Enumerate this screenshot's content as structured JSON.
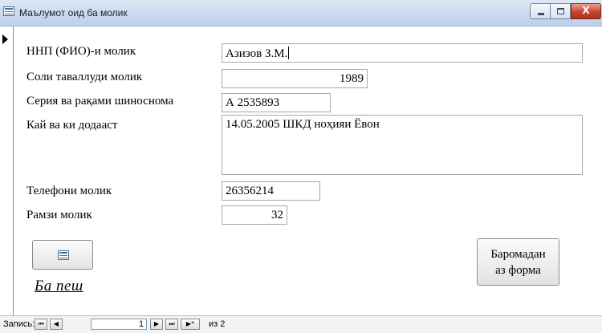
{
  "window": {
    "title": "Маълумот оид ба молик",
    "clipped_text": "...",
    "controls": {
      "minimize_icon": "minimize-icon",
      "maximize_icon": "maximize-icon",
      "close_icon": "close-icon",
      "close_glyph": "X"
    }
  },
  "form": {
    "fields": [
      {
        "label": "ННП (ФИО)-и молик",
        "value": "Азизов З.М."
      },
      {
        "label": "Соли таваллуди молик",
        "value": "1989"
      },
      {
        "label": "Серия ва рақами шиносномa",
        "value": "А 2535893"
      },
      {
        "label": "Кай ва ки додааст",
        "value": "14.05.2005 ШКД ноҳияи Ёвон"
      },
      {
        "label": "Телефони молик",
        "value": "26356214"
      },
      {
        "label": "Рамзи молик",
        "value": "32"
      }
    ],
    "icon_button": "form-icon",
    "back_link": "Ба пеш",
    "open_form_button": {
      "line1": "Баромадан",
      "line2": "аз форма"
    }
  },
  "navigation": {
    "label": "Запись:",
    "current": "1",
    "of_text": "из 2",
    "first": "⏮",
    "prev": "◀",
    "next": "▶",
    "last": "⏭",
    "new": "▶*"
  }
}
